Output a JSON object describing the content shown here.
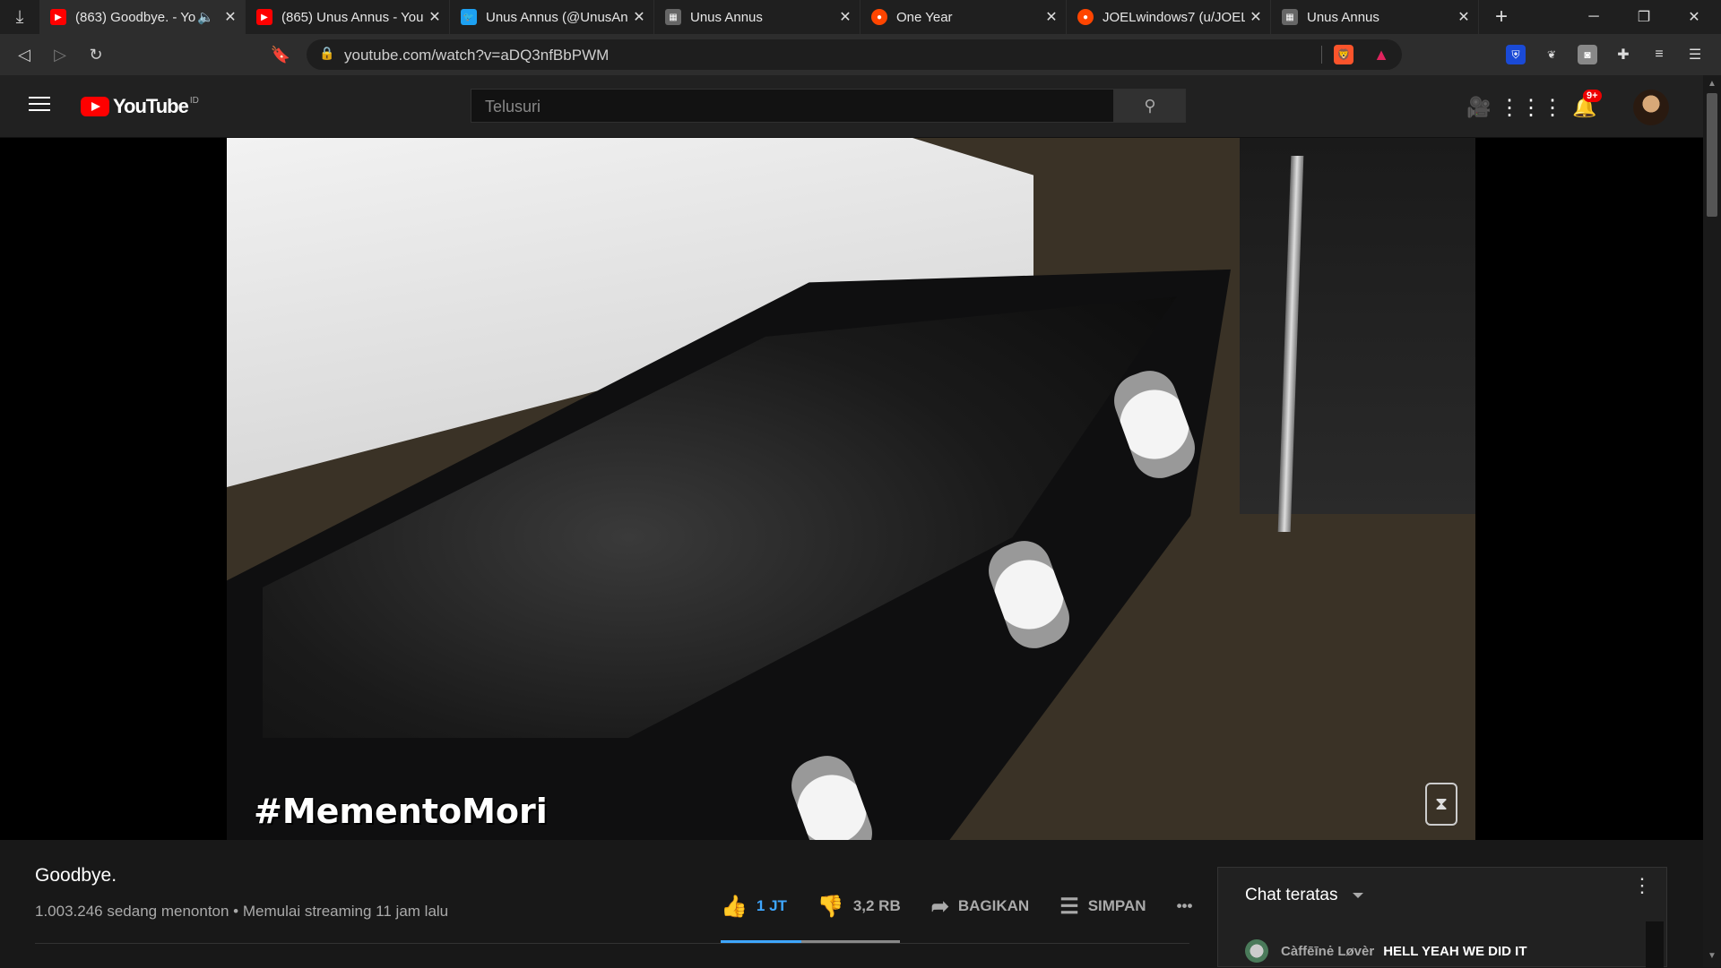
{
  "browser": {
    "tabs": [
      {
        "title": "(863) Goodbye. - Yo",
        "icon": "youtube-icon",
        "color": "#ff0000"
      },
      {
        "title": "(865) Unus Annus - You",
        "icon": "youtube-icon",
        "color": "#ff0000"
      },
      {
        "title": "Unus Annus (@UnusAnn",
        "icon": "twitter-icon",
        "color": "#1da1f2"
      },
      {
        "title": "Unus Annus",
        "icon": "page-icon",
        "color": "#888888"
      },
      {
        "title": "One Year",
        "icon": "reddit-icon",
        "color": "#ff4500"
      },
      {
        "title": "JOELwindows7 (u/JOELw",
        "icon": "reddit-icon",
        "color": "#ff4500"
      },
      {
        "title": "Unus Annus",
        "icon": "page-icon",
        "color": "#888888"
      }
    ],
    "url": "youtube.com/watch?v=aDQ3nfBbPWM"
  },
  "youtube": {
    "logo_text": "YouTube",
    "country_code": "ID",
    "search_placeholder": "Telusuri",
    "notification_count": "9+"
  },
  "video": {
    "overlay_hashtag": "#MementoMori",
    "title": "Goodbye.",
    "meta": "1.003.246 sedang menonton • Memulai streaming 11 jam lalu",
    "likes": "1 JT",
    "dislikes": "3,2 RB",
    "share_label": "BAGIKAN",
    "save_label": "SIMPAN",
    "more_label": "•••",
    "like_ratio": 0.45
  },
  "chat": {
    "header": "Chat teratas",
    "messages": [
      {
        "author": "Càffēīnė Løvèr",
        "text": "HELL YEAH WE DID IT"
      }
    ]
  },
  "colors": {
    "accent": "#3ea6ff",
    "brand": "#ff0000"
  }
}
